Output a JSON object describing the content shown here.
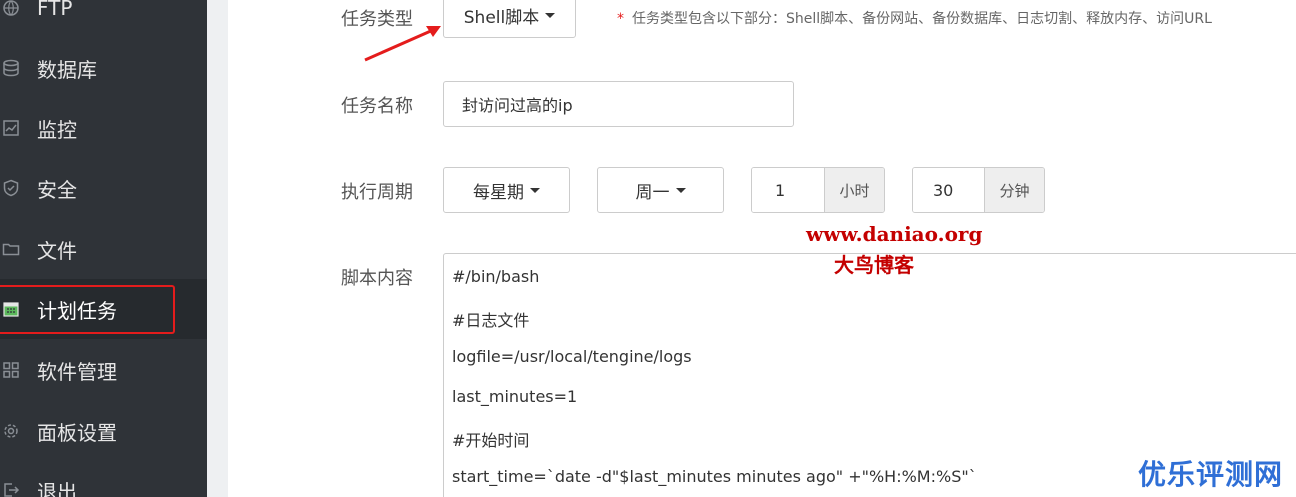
{
  "sidebar": {
    "items": [
      {
        "label": "FTP",
        "icon": "ftp-icon"
      },
      {
        "label": "数据库",
        "icon": "database-icon"
      },
      {
        "label": "监控",
        "icon": "monitor-icon"
      },
      {
        "label": "安全",
        "icon": "shield-icon"
      },
      {
        "label": "文件",
        "icon": "folder-icon"
      },
      {
        "label": "计划任务",
        "icon": "calendar-icon",
        "active": true
      },
      {
        "label": "软件管理",
        "icon": "grid-icon"
      },
      {
        "label": "面板设置",
        "icon": "gear-icon"
      },
      {
        "label": "退出",
        "icon": "logout-icon"
      }
    ]
  },
  "form": {
    "task_type_label": "任务类型",
    "task_type_value": "Shell脚本",
    "task_type_hint_star": "*",
    "task_type_hint": "任务类型包含以下部分：Shell脚本、备份网站、备份数据库、日志切割、释放内存、访问URL",
    "task_name_label": "任务名称",
    "task_name_value": "封访问过高的ip",
    "cycle_label": "执行周期",
    "cycle_type": "每星期",
    "cycle_weekday": "周一",
    "cycle_hour": "1",
    "cycle_hour_unit": "小时",
    "cycle_minute": "30",
    "cycle_minute_unit": "分钟",
    "script_label": "脚本内容",
    "script_lines": [
      "#/bin/bash",
      "#日志文件",
      "logfile=/usr/local/tengine/logs",
      "last_minutes=1",
      "#开始时间",
      "start_time=`date -d\"$last_minutes minutes ago\" +\"%H:%M:%S\"`"
    ]
  },
  "watermarks": {
    "url": "www.daniao.org",
    "site_name": "大鸟博客",
    "corner": "优乐评测网"
  },
  "colors": {
    "sidebar_bg": "#2f3338",
    "highlight_red": "#e41c1c",
    "watermark_red": "#c40000",
    "corner_blue": "#2f6fd6"
  }
}
